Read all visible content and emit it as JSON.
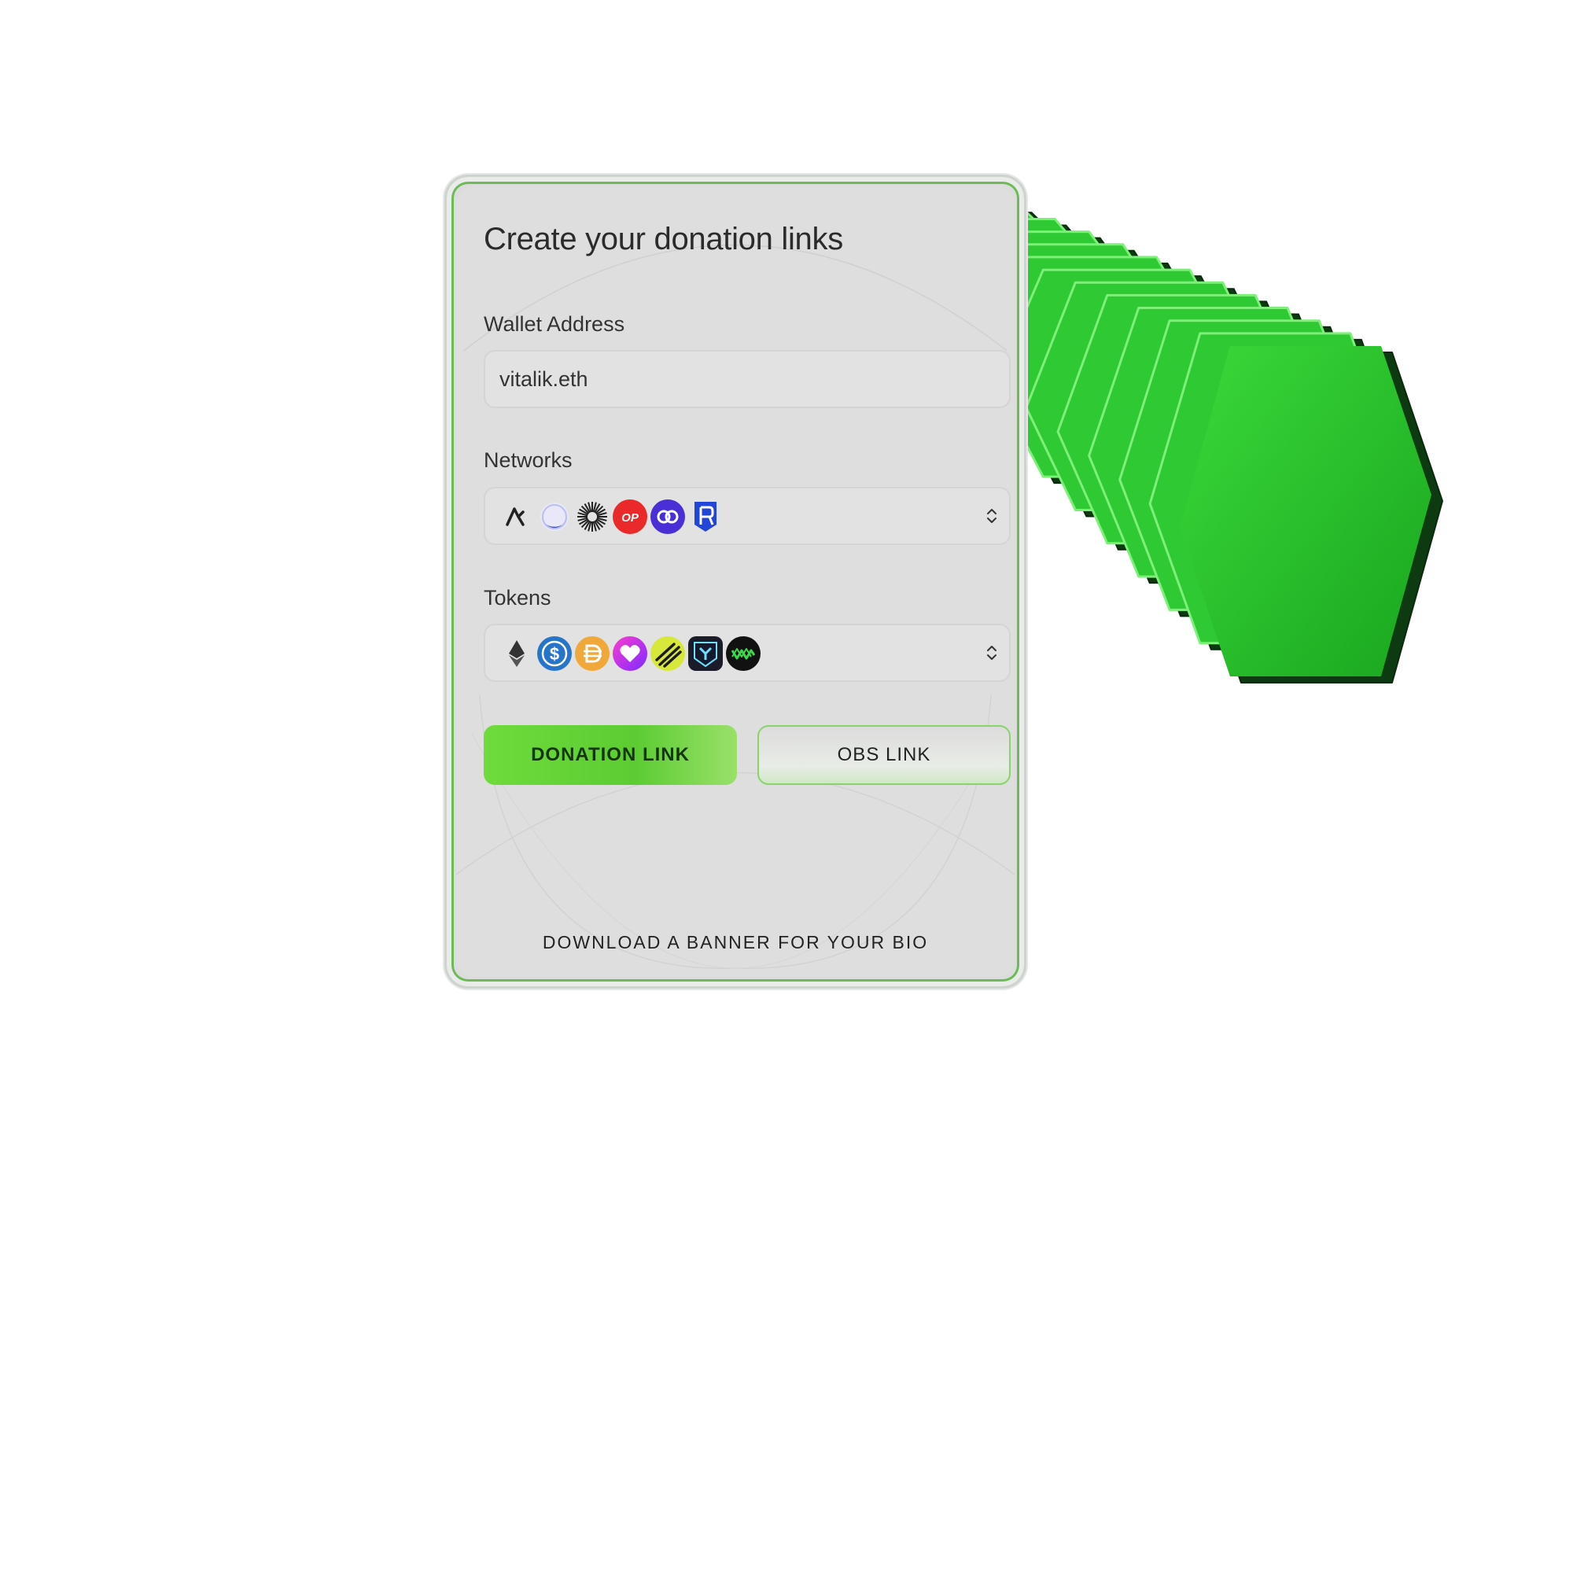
{
  "form": {
    "title": "Create your donation links",
    "wallet": {
      "label": "Wallet Address",
      "value": "vitalik.eth"
    },
    "networks": {
      "label": "Networks",
      "icons": [
        "arbitrum-icon",
        "base-icon",
        "zksync-icon",
        "optimism-icon",
        "polygon-icon",
        "ronin-icon"
      ]
    },
    "tokens": {
      "label": "Tokens",
      "icons": [
        "eth-icon",
        "usdc-icon",
        "dai-icon",
        "token-heart-icon",
        "token-stripes-icon",
        "token-shield-icon",
        "token-m-icon"
      ]
    },
    "buttons": {
      "donation": "DONATION LINK",
      "obs": "OBS LINK"
    },
    "footer": "DOWNLOAD A BANNER FOR YOUR BIO"
  },
  "colors": {
    "accent": "#5ccc32",
    "panel": "#dcdcdc",
    "border_green": "#6dbb57",
    "deco_green": "#22c02a"
  }
}
